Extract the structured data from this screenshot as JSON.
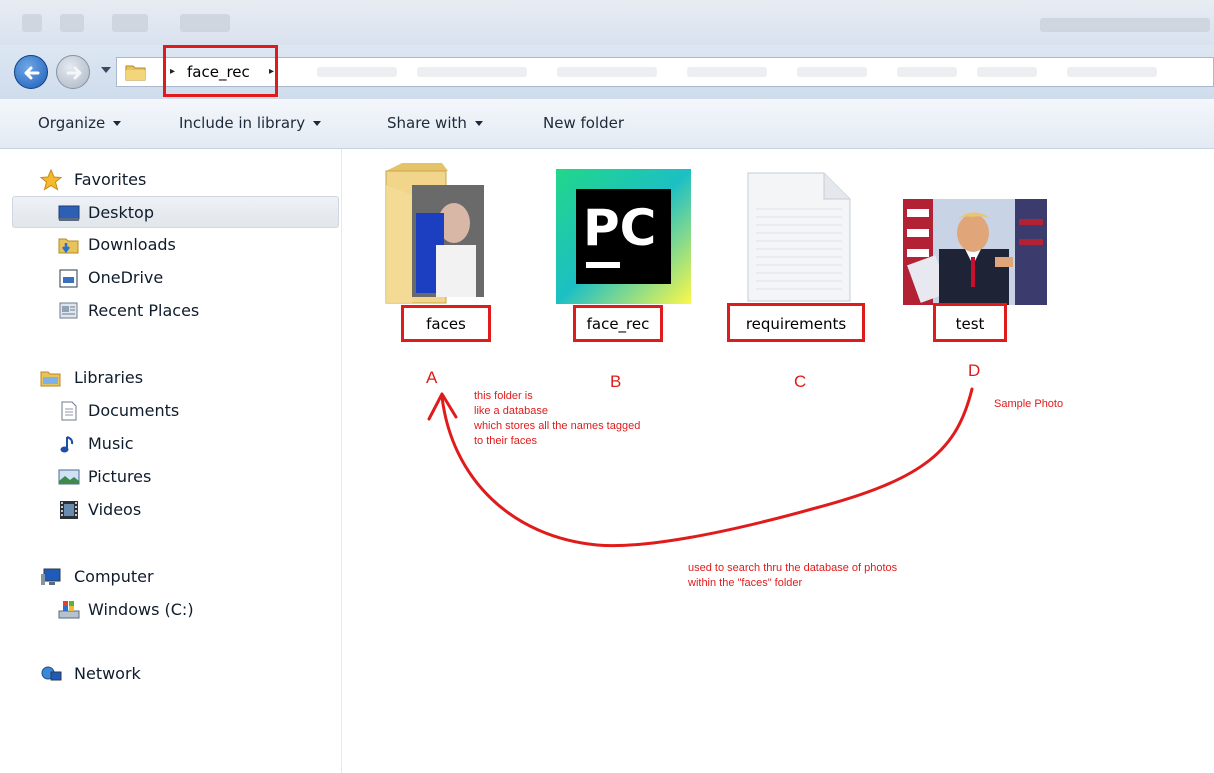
{
  "window": {
    "address": {
      "crumb": "face_rec"
    },
    "toolbar": {
      "organize": "Organize",
      "include_in_library": "Include in library",
      "share_with": "Share with",
      "new_folder": "New folder"
    }
  },
  "sidebar": {
    "favorites": "Favorites",
    "desktop": "Desktop",
    "downloads": "Downloads",
    "onedrive": "OneDrive",
    "recent_places": "Recent Places",
    "libraries": "Libraries",
    "documents": "Documents",
    "music": "Music",
    "pictures": "Pictures",
    "videos": "Videos",
    "computer": "Computer",
    "windows_c": "Windows (C:)",
    "network": "Network"
  },
  "files": [
    {
      "name": "faces",
      "type": "folder",
      "annotation_letter": "A"
    },
    {
      "name": "face_rec",
      "type": "pycharm-project",
      "annotation_letter": "B"
    },
    {
      "name": "requirements",
      "type": "text-document",
      "annotation_letter": "C"
    },
    {
      "name": "test",
      "type": "photo",
      "annotation_letter": "D"
    }
  ],
  "annotations": {
    "a_note": [
      "this folder is",
      "like a database",
      "which stores all the names tagged",
      "to their faces"
    ],
    "d_note": "Sample Photo",
    "arrow_note": [
      "used to search thru the database of photos",
      "within the \"faces\" folder"
    ],
    "highlight_color": "#e01b1b",
    "pycharm_logo_text": "PC"
  }
}
